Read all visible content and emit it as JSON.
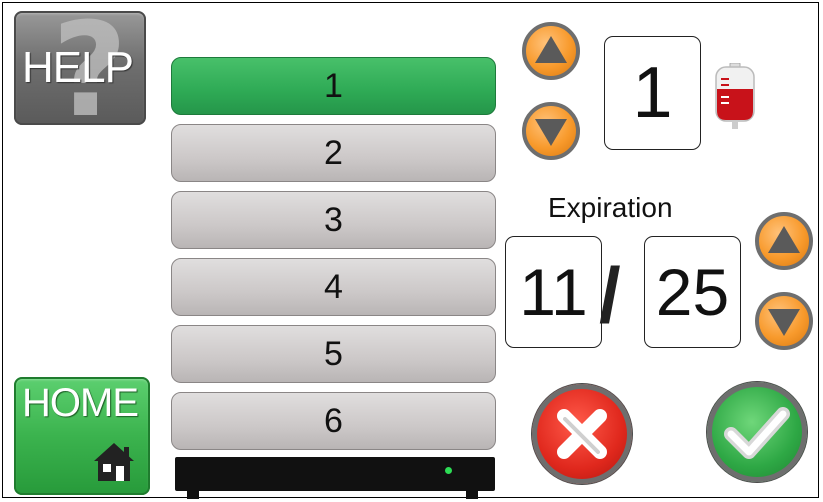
{
  "help_button": {
    "label": "HELP",
    "icon": "question-mark-icon"
  },
  "home_button": {
    "label": "HOME",
    "icon": "house-icon"
  },
  "slots": [
    {
      "label": "1",
      "selected": true
    },
    {
      "label": "2",
      "selected": false
    },
    {
      "label": "3",
      "selected": false
    },
    {
      "label": "4",
      "selected": false
    },
    {
      "label": "5",
      "selected": false
    },
    {
      "label": "6",
      "selected": false
    }
  ],
  "quantity": {
    "value": "1",
    "icon": "blood-bag-icon"
  },
  "expiration": {
    "label": "Expiration",
    "month": "11",
    "separator": "/",
    "year": "25"
  },
  "actions": {
    "cancel_icon": "x-icon",
    "confirm_icon": "checkmark-icon"
  },
  "colors": {
    "selected_slot": "#2eaa55",
    "slot": "#ccc8c8",
    "arrow_button": "#f89a2c",
    "cancel": "#e0281d",
    "confirm": "#2ea845"
  }
}
